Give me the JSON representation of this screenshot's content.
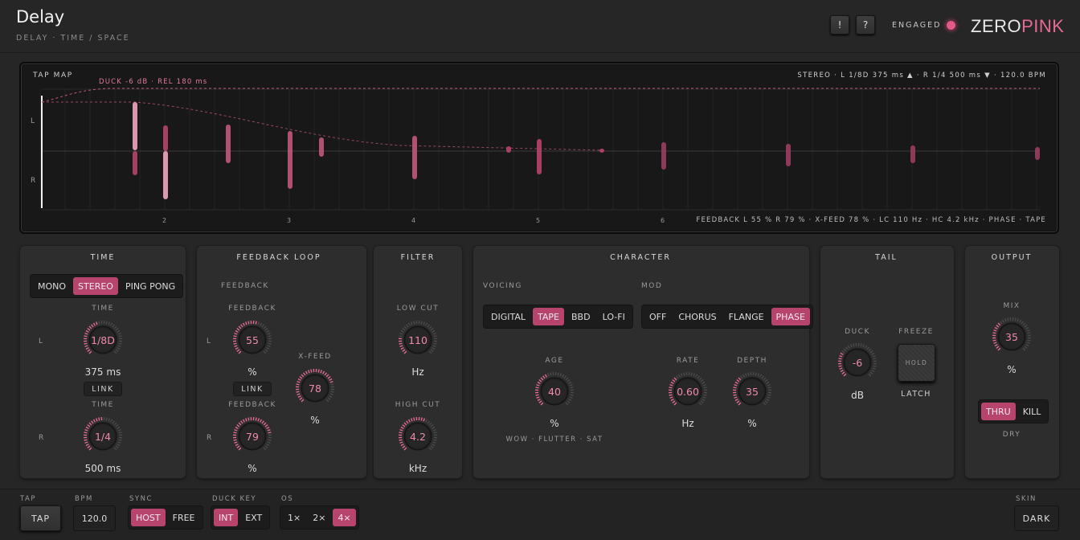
{
  "header": {
    "title": "Delay",
    "subtitle": "DELAY · TIME / SPACE",
    "alert_btn": "!",
    "help_btn": "?",
    "engaged_label": "ENGAGED",
    "brand_a": "ZERO",
    "brand_b": "PINK",
    "accent": "#e76a93"
  },
  "tapmap": {
    "label": "TAP MAP",
    "duck": "DUCK -6 dB · REL 180 ms",
    "status": "STEREO · L 1/8D 375 ms ▲ · R 1/4 500 ms ▼ · 120.0 BPM",
    "ch_l": "L",
    "ch_r": "R",
    "beats": [
      "2",
      "3",
      "4",
      "5",
      "6"
    ],
    "info": "FEEDBACK L 55 % R 79 % · X-FEED 78 % · LC 110 Hz · HC 4.2 kHz · PHASE · TAPE"
  },
  "time": {
    "title": "TIME",
    "modes": [
      "MONO",
      "STEREO",
      "PING PONG"
    ],
    "mode_active": 1,
    "l_label": "TIME",
    "l_ch": "L",
    "l_value": "1/8D",
    "l_ms": "375 ms",
    "link": "LINK",
    "r_label": "TIME",
    "r_ch": "R",
    "r_value": "1/4",
    "r_ms": "500 ms"
  },
  "feedback": {
    "title": "FEEDBACK LOOP",
    "section": "FEEDBACK",
    "l_label": "FEEDBACK",
    "l_ch": "L",
    "l_value": "55",
    "l_unit": "%",
    "link": "LINK",
    "r_label": "FEEDBACK",
    "r_ch": "R",
    "r_value": "79",
    "r_unit": "%",
    "xfeed_label": "X-FEED",
    "xfeed_value": "78",
    "xfeed_unit": "%"
  },
  "filter": {
    "title": "FILTER",
    "low_label": "LOW CUT",
    "low_value": "110",
    "low_unit": "Hz",
    "high_label": "HIGH CUT",
    "high_value": "4.2",
    "high_unit": "kHz"
  },
  "character": {
    "title": "CHARACTER",
    "voicing_label": "VOICING",
    "voicing": [
      "DIGITAL",
      "TAPE",
      "BBD",
      "LO-FI"
    ],
    "voicing_active": 1,
    "mod_label": "MOD",
    "mod": [
      "OFF",
      "CHORUS",
      "FLANGE",
      "PHASE"
    ],
    "mod_active": 3,
    "age_label": "AGE",
    "age_value": "40",
    "age_unit": "%",
    "age_note": "WOW · FLUTTER · SAT",
    "rate_label": "RATE",
    "rate_value": "0.60",
    "rate_unit": "Hz",
    "depth_label": "DEPTH",
    "depth_value": "35",
    "depth_unit": "%"
  },
  "tail": {
    "title": "TAIL",
    "duck_label": "DUCK",
    "duck_value": "-6",
    "duck_unit": "dB",
    "freeze_label": "FREEZE",
    "hold": "HOLD",
    "latch": "LATCH"
  },
  "output": {
    "title": "OUTPUT",
    "mix_label": "MIX",
    "mix_value": "35",
    "mix_unit": "%",
    "dry_modes": [
      "THRU",
      "KILL"
    ],
    "dry_active": 0,
    "dry_label": "DRY"
  },
  "footer": {
    "tap_label": "TAP",
    "tap_btn": "TAP",
    "bpm_label": "BPM",
    "bpm_value": "120.0",
    "sync_label": "SYNC",
    "sync": [
      "HOST",
      "FREE"
    ],
    "sync_active": 0,
    "duckkey_label": "DUCK KEY",
    "duckkey": [
      "INT",
      "EXT"
    ],
    "duckkey_active": 0,
    "os_label": "OS",
    "os": [
      "1×",
      "2×",
      "4×"
    ],
    "os_active": 2,
    "skin_label": "SKIN",
    "skin_value": "DARK"
  }
}
